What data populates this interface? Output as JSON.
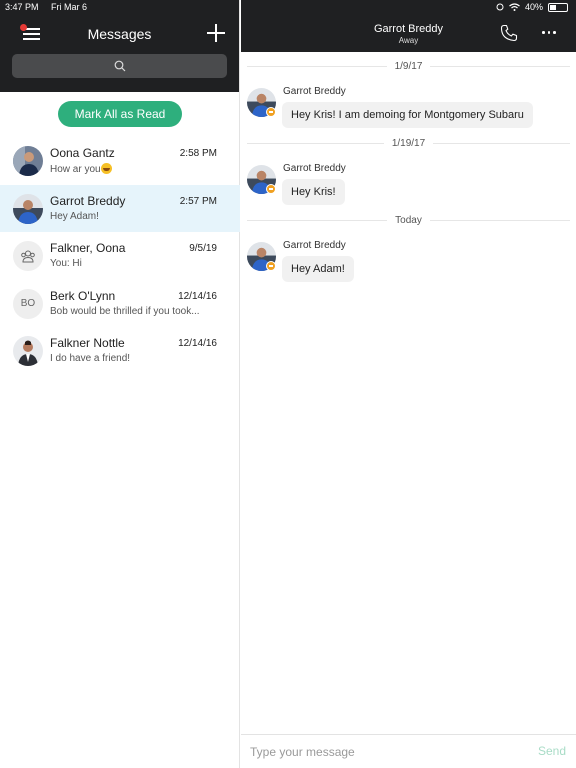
{
  "status_bar": {
    "time": "3:47 PM",
    "date": "Fri Mar 6",
    "battery": "40%",
    "battery_level": 0.4
  },
  "left_header": {
    "title": "Messages"
  },
  "actions": {
    "mark_all_read": "Mark All as Read"
  },
  "conversations": [
    {
      "name": "Oona Gantz",
      "time": "2:58 PM",
      "preview": "How ar you",
      "has_emoji": true,
      "avatar": "photo"
    },
    {
      "name": "Garrot Breddy",
      "time": "2:57 PM",
      "preview": "Hey Adam!",
      "selected": true,
      "avatar": "photo"
    },
    {
      "name": "Falkner, Oona",
      "time": "9/5/19",
      "preview": "You: Hi",
      "avatar": "group-icon"
    },
    {
      "name": "Berk O'Lynn",
      "time": "12/14/16",
      "preview": "Bob would be thrilled if you took...",
      "avatar": "BO"
    },
    {
      "name": "Falkner Nottle",
      "time": "12/14/16",
      "preview": "I do have a friend!",
      "avatar": "photo"
    }
  ],
  "chat_header": {
    "name": "Garrot Breddy",
    "status": "Away"
  },
  "chat": {
    "date_separators": [
      "1/9/17",
      "1/19/17",
      "Today"
    ],
    "messages": [
      {
        "sender": "Garrot Breddy",
        "text": "Hey Kris! I am demoing for Montgomery Subaru"
      },
      {
        "sender": "Garrot Breddy",
        "text": "Hey Kris!"
      },
      {
        "sender": "Garrot Breddy",
        "text": "Hey Adam!"
      }
    ]
  },
  "composer": {
    "placeholder": "Type your message",
    "send": "Send"
  },
  "colors": {
    "header_bg": "#1f2022",
    "accent_green": "#2eaf7d",
    "selected_row": "#e6f4fb",
    "away_status": "#f0a020",
    "send_disabled": "#a8dcc6"
  }
}
